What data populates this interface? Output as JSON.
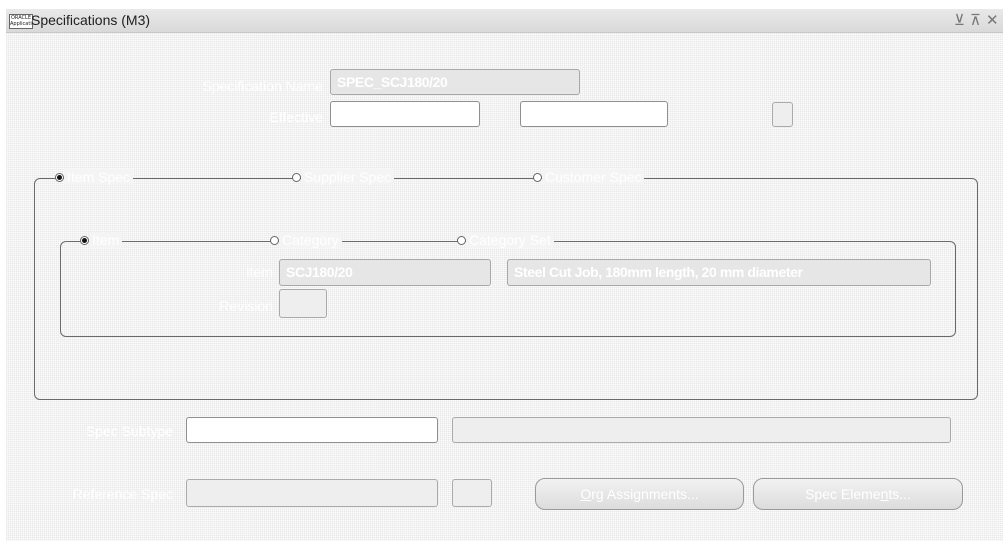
{
  "window": {
    "title": "Specifications (M3)",
    "icon_text": "ORACLE Applications",
    "controls": {
      "minimize": "⊻",
      "maximize": "⊼",
      "close": "✕"
    }
  },
  "spec": {
    "name_label": "Specification Name",
    "name_value": "SPEC_SCJ180/20",
    "effective_label": "Effective",
    "effective_from": "",
    "effective_to": "",
    "flex_value": ""
  },
  "type_radios": [
    {
      "label": "Item Spec",
      "selected": true
    },
    {
      "label": "Supplier Spec",
      "selected": false
    },
    {
      "label": "Customer Spec",
      "selected": false
    }
  ],
  "scope_radios": [
    {
      "label": "Item",
      "selected": true
    },
    {
      "label": "Category",
      "selected": false
    },
    {
      "label": "Category Set",
      "selected": false
    }
  ],
  "item": {
    "label": "Item",
    "code": "SCJ180/20",
    "description": "Steel Cut Job, 180mm length, 20 mm diameter",
    "revision_label": "Revision",
    "revision_value": ""
  },
  "subtype": {
    "label": "Spec Subtype",
    "value": "",
    "description": ""
  },
  "reference": {
    "label": "Reference Spec",
    "value": "",
    "extra": ""
  },
  "buttons": {
    "org_assignments_prefix": "",
    "org_assignments_mnemonic": "O",
    "org_assignments_rest": "rg Assignments...",
    "spec_elements_prefix": "Spec Eleme",
    "spec_elements_mnemonic": "n",
    "spec_elements_rest": "ts..."
  },
  "colors": {
    "frame_line": "#6a6a6a",
    "window_bg": "#f4f4f4",
    "label_text": "#ffffff"
  }
}
